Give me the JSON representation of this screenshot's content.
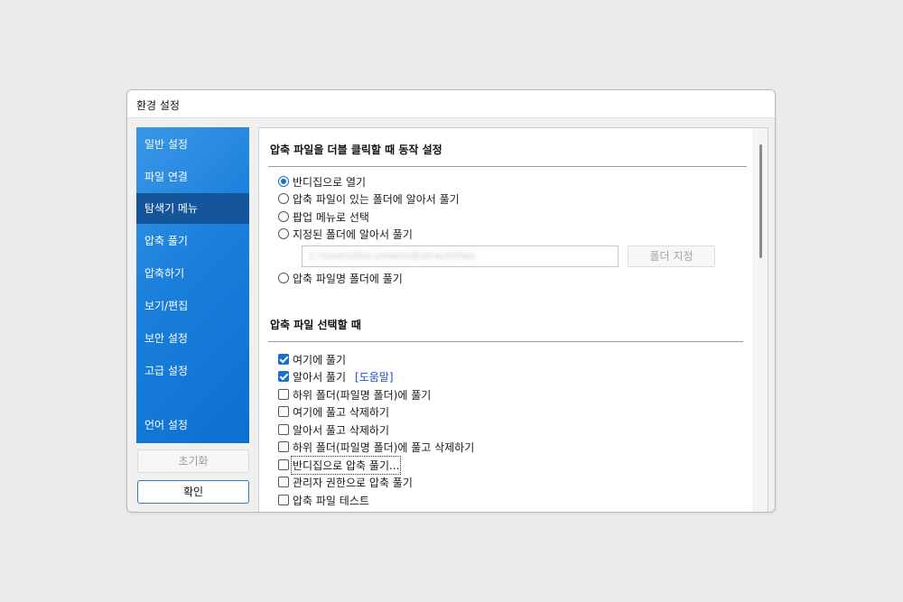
{
  "window": {
    "title": "환경 설정"
  },
  "sidebar": {
    "items": [
      {
        "label": "일반 설정",
        "active": false
      },
      {
        "label": "파일 연결",
        "active": false
      },
      {
        "label": "탐색기 메뉴",
        "active": true
      },
      {
        "label": "압축 풀기",
        "active": false
      },
      {
        "label": "압축하기",
        "active": false
      },
      {
        "label": "보기/편집",
        "active": false
      },
      {
        "label": "보안 설정",
        "active": false
      },
      {
        "label": "고급 설정",
        "active": false
      },
      {
        "label": "언어 설정",
        "active": false
      }
    ],
    "reset_label": "초기화",
    "ok_label": "확인"
  },
  "double_click": {
    "title": "압축 파일을 더블 클릭할 때 동작 설정",
    "options": [
      {
        "label": "반디집으로 열기",
        "selected": true
      },
      {
        "label": "압축 파일이 있는 폴더에 알아서 풀기",
        "selected": false
      },
      {
        "label": "팝업 메뉴로 선택",
        "selected": false
      },
      {
        "label": "지정된 폴더에 알아서 풀기",
        "selected": false
      },
      {
        "label": "압축 파일명 폴더에 풀기",
        "selected": false
      }
    ],
    "folder_path": "C:\\Users\\Documents\\Extract\\Files",
    "folder_button_label": "폴더 지정"
  },
  "on_select": {
    "title": "압축 파일 선택할 때",
    "help_link": "[도움말]",
    "options": [
      {
        "label": "여기에 풀기",
        "checked": true
      },
      {
        "label": "알아서 풀기",
        "checked": true
      },
      {
        "label": "하위 폴더(파일명 폴더)에 풀기",
        "checked": false
      },
      {
        "label": "여기에 풀고 삭제하기",
        "checked": false
      },
      {
        "label": "알아서 풀고 삭제하기",
        "checked": false
      },
      {
        "label": "하위 폴더(파일명 폴더)에 풀고 삭제하기",
        "checked": false
      },
      {
        "label": "반디집으로 압축 풀기...",
        "checked": false
      },
      {
        "label": "관리자 권한으로 압축 풀기",
        "checked": false
      },
      {
        "label": "압축 파일 테스트",
        "checked": false
      }
    ]
  },
  "colors": {
    "accent": "#1b6fc9",
    "sidebar_top": "#3a97e6",
    "sidebar_bottom": "#0d6fd0",
    "sidebar_active": "#14559b",
    "link": "#1b4fc9"
  }
}
